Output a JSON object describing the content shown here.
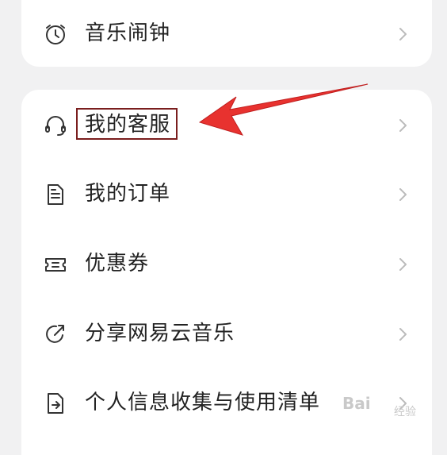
{
  "menu_top": [
    {
      "label": "音乐闹钟",
      "icon": "alarm-clock-icon"
    }
  ],
  "menu_main": [
    {
      "label": "我的客服",
      "icon": "headset-icon"
    },
    {
      "label": "我的订单",
      "icon": "document-icon"
    },
    {
      "label": "优惠券",
      "icon": "coupon-icon"
    },
    {
      "label": "分享网易云音乐",
      "icon": "share-icon"
    },
    {
      "label": "个人信息收集与使用清单",
      "icon": "info-list-icon"
    }
  ],
  "annotation": {
    "color": "#e8322f",
    "highlight_color": "#7a1e1e"
  },
  "watermark": {
    "text": "Bai",
    "sub": "经验"
  }
}
